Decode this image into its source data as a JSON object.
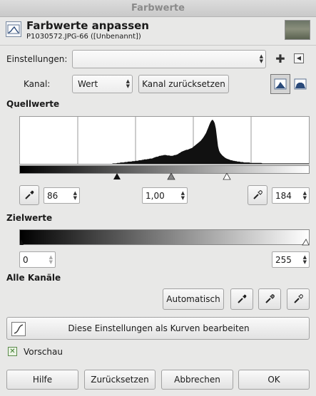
{
  "window": {
    "title": "Farbwerte"
  },
  "header": {
    "title": "Farbwerte anpassen",
    "subtitle": "P1030572.JPG-66 ([Unbenannt])"
  },
  "presets": {
    "label": "Einstellungen:",
    "value": "",
    "add_icon": "plus-icon",
    "menu_icon": "menu-arrow-icon"
  },
  "channel": {
    "label": "Kanal:",
    "value": "Wert",
    "reset_label": "Kanal zurücksetzen",
    "linear_icon": "linear-histogram-icon",
    "log_icon": "log-histogram-icon"
  },
  "input_levels": {
    "heading": "Quellwerte",
    "low": "86",
    "gamma": "1,00",
    "high": "184",
    "histogram": [
      0,
      0,
      0,
      0,
      0,
      0,
      0,
      0,
      0,
      0,
      0,
      0,
      0,
      0,
      0,
      0,
      0,
      0,
      0,
      0,
      0,
      0,
      0,
      0,
      0,
      0,
      0,
      0,
      0,
      0,
      0,
      0,
      0,
      0,
      0,
      0,
      0,
      0,
      0,
      0,
      0,
      0,
      0,
      0,
      0,
      0,
      0,
      0,
      0,
      0,
      0,
      0,
      0,
      0,
      0,
      0,
      0,
      0,
      0,
      0,
      0,
      0,
      0,
      0,
      0,
      0,
      0,
      0,
      0,
      0,
      0,
      0,
      0,
      0,
      0,
      0,
      0,
      0,
      0,
      0,
      0,
      0,
      0,
      0,
      0,
      0,
      1,
      1,
      1,
      1,
      2,
      2,
      2,
      3,
      3,
      3,
      3,
      4,
      4,
      4,
      5,
      5,
      5,
      5,
      6,
      6,
      6,
      7,
      7,
      7,
      8,
      8,
      8,
      9,
      9,
      10,
      10,
      10,
      11,
      11,
      12,
      12,
      12,
      13,
      14,
      15,
      16,
      16,
      17,
      18,
      18,
      19,
      19,
      20,
      20,
      20,
      19,
      19,
      19,
      18,
      18,
      18,
      19,
      20,
      20,
      21,
      22,
      24,
      25,
      27,
      28,
      29,
      30,
      31,
      32,
      32,
      33,
      34,
      35,
      36,
      38,
      40,
      42,
      44,
      46,
      48,
      50,
      52,
      55,
      58,
      62,
      66,
      70,
      76,
      82,
      88,
      94,
      98,
      100,
      97,
      92,
      80,
      60,
      40,
      30,
      25,
      22,
      19,
      17,
      15,
      13,
      12,
      11,
      10,
      9,
      8,
      8,
      7,
      7,
      6,
      6,
      5,
      5,
      5,
      4,
      4,
      4,
      3,
      3,
      3,
      3,
      3,
      3,
      2,
      2,
      2,
      2,
      2,
      2,
      2,
      2,
      2,
      2,
      2,
      1,
      1,
      1,
      1,
      1,
      1,
      1,
      1,
      1,
      1,
      1,
      1,
      1,
      1,
      1,
      1,
      1,
      1,
      1,
      1,
      1,
      1,
      1,
      1,
      1,
      1,
      1,
      1,
      1,
      1,
      1,
      1,
      1,
      1,
      1,
      1,
      1,
      1,
      1,
      1,
      1,
      1,
      1,
      1
    ]
  },
  "output_levels": {
    "heading": "Zielwerte",
    "low": "0",
    "high": "255"
  },
  "all_channels": {
    "heading": "Alle Kanäle",
    "auto_label": "Automatisch",
    "curves_label": "Diese Einstellungen als Kurven bearbeiten"
  },
  "preview": {
    "label": "Vorschau",
    "checked": true
  },
  "footer": {
    "help": "Hilfe",
    "reset": "Zurücksetzen",
    "cancel": "Abbrechen",
    "ok": "OK"
  }
}
